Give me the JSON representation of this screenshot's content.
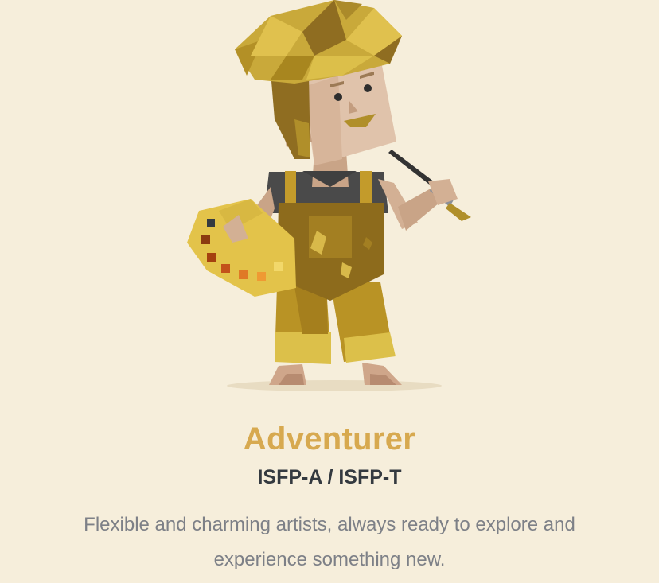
{
  "personality": {
    "name": "Adventurer",
    "code": "ISFP-A / ISFP-T",
    "description": "Flexible and charming artists, always ready to explore and experience something new."
  },
  "illustration": {
    "icon": "adventurer-artist-illustration",
    "colors": {
      "accent": "#d7a94f",
      "background": "#f6eedb",
      "overalls": "#b08f2a",
      "palette": "#e3c34a",
      "skin": "#d9b89c",
      "hair": "#c9a93a"
    }
  }
}
